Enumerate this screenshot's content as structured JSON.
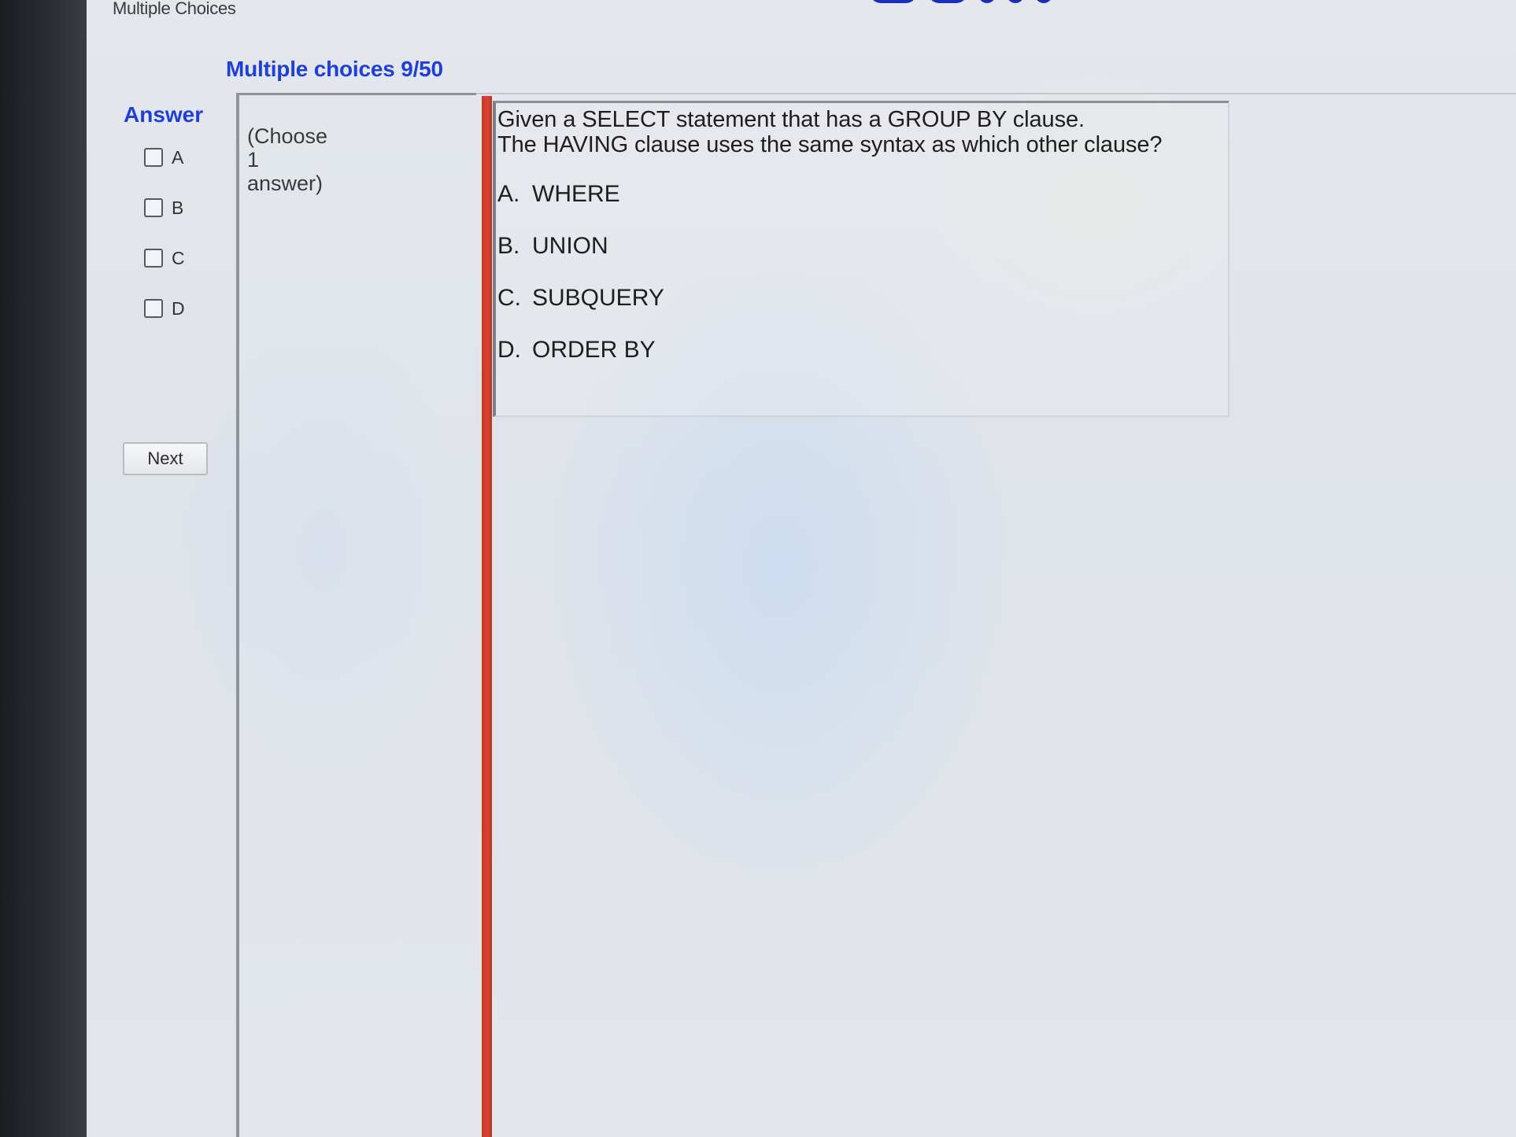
{
  "window": {
    "title": "Multiple Choices"
  },
  "header": {
    "section_title": "Multiple choices 9/50"
  },
  "answer_panel": {
    "heading": "Answer",
    "choices": [
      {
        "label": "A",
        "checked": false
      },
      {
        "label": "B",
        "checked": false
      },
      {
        "label": "C",
        "checked": false
      },
      {
        "label": "D",
        "checked": false
      }
    ],
    "next_label": "Next"
  },
  "instruction": {
    "lines": [
      "(Choose",
      "1",
      "answer)"
    ]
  },
  "question": {
    "lines": [
      "Given a SELECT statement that has a GROUP BY clause.",
      "The HAVING clause uses the same syntax as which other clause?"
    ],
    "options": [
      {
        "letter": "A.",
        "text": "WHERE"
      },
      {
        "letter": "B.",
        "text": "UNION"
      },
      {
        "letter": "C.",
        "text": "SUBQUERY"
      },
      {
        "letter": "D.",
        "text": "ORDER BY"
      }
    ]
  },
  "colors": {
    "heading_blue": "#1f3fd6",
    "divider_red": "#d9442f"
  }
}
